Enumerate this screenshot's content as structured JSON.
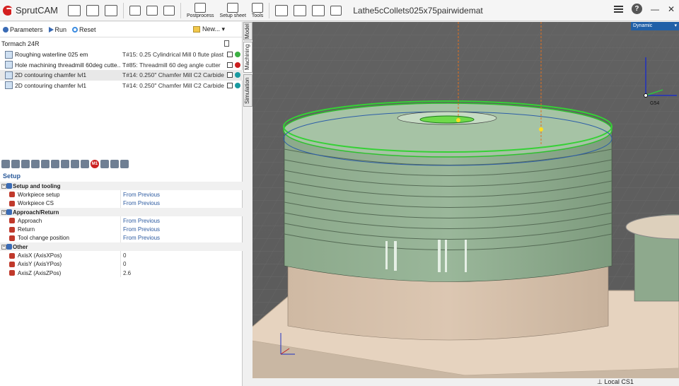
{
  "app": {
    "name": "SprutCAM",
    "document_title": "Lathe5cCollets025x75pairwidemat"
  },
  "toolbar": {
    "postprocess_label": "Postprocess",
    "setup_sheet_label": "Setup sheet",
    "tools_label": "Tools"
  },
  "ops_toolbar": {
    "parameters_label": "Parameters",
    "run_label": "Run",
    "reset_label": "Reset",
    "new_label": "New..."
  },
  "machine": {
    "name": "Tormach 24R"
  },
  "operations": [
    {
      "name": "Roughing waterline 025 em",
      "tool": "T#15: 0.25 Cylindrical Mill 0 flute plast",
      "status_color": "#3cb043",
      "selected": false
    },
    {
      "name": "Hole machining threadmill 60deg cutte...",
      "tool": "T#85: Threadmill 60 deg angle cutter",
      "status_color": "#cc2020",
      "selected": false
    },
    {
      "name": "2D contouring chamfer lvl1",
      "tool": "T#14: 0.250\" Chamfer Mill C2 Carbide",
      "status_color": "#1a9aa0",
      "selected": true
    },
    {
      "name": "2D contouring chamfer lvl1",
      "tool": "T#14: 0.250\" Chamfer Mill C2 Carbide",
      "status_color": "#1a9aa0",
      "selected": false
    }
  ],
  "side_tabs": {
    "model": "Model",
    "machining": "Machining",
    "simulation": "Simulation"
  },
  "setup": {
    "title": "Setup",
    "rows": [
      {
        "type": "group",
        "name": "Setup and tooling",
        "value": ""
      },
      {
        "type": "item",
        "name": "Workpiece setup",
        "value": "From Previous"
      },
      {
        "type": "item",
        "name": "Workpiece CS",
        "value": "From Previous"
      },
      {
        "type": "group",
        "name": "Approach/Return",
        "value": ""
      },
      {
        "type": "item",
        "name": "Approach",
        "value": "From Previous"
      },
      {
        "type": "item",
        "name": "Return",
        "value": "From Previous"
      },
      {
        "type": "item",
        "name": "Tool change position",
        "value": "From Previous"
      },
      {
        "type": "group",
        "name": "Other",
        "value": ""
      },
      {
        "type": "item",
        "name": "AxisX (AxisXPos)",
        "value": "0"
      },
      {
        "type": "item",
        "name": "AxisY (AxisYPos)",
        "value": "0"
      },
      {
        "type": "item",
        "name": "AxisZ (AxisZPos)",
        "value": "2.6"
      }
    ]
  },
  "viewport": {
    "view_mode": "Dynamic",
    "cs_label": "G54",
    "status_cs": "Local CS1"
  },
  "colors": {
    "accent": "#2060a8",
    "part_green": "#8fae8e",
    "stock_tan": "#d9c3ad",
    "floor": "#e8d6c2"
  }
}
